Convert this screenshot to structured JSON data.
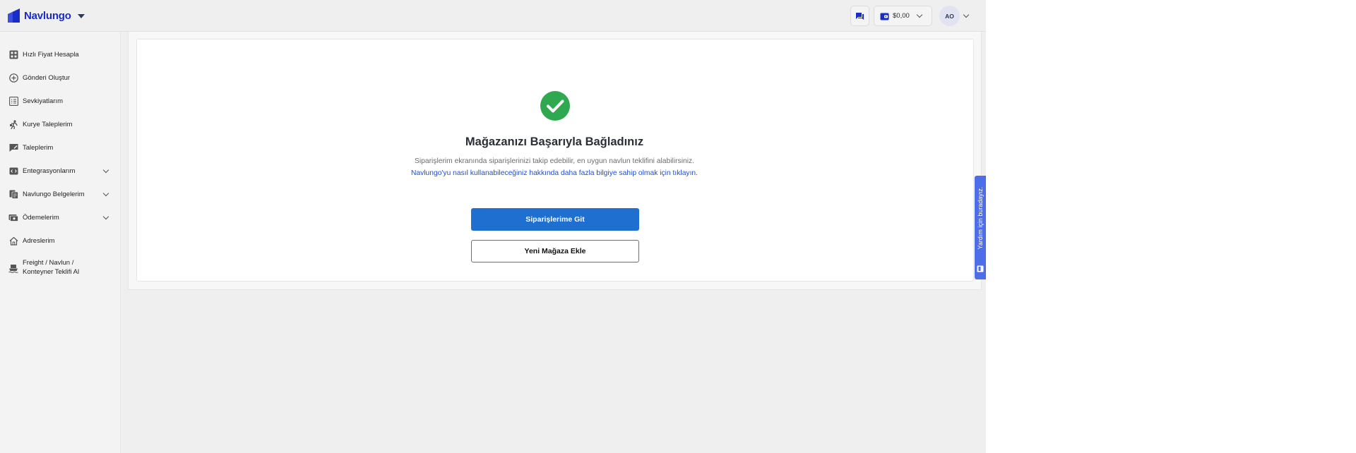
{
  "header": {
    "brand": "Navlungo",
    "wallet_amount": "$0,00",
    "user_initials": "AO"
  },
  "sidebar": {
    "items": [
      {
        "label": "Hızlı Fiyat Hesapla",
        "icon": "calculator-icon"
      },
      {
        "label": "Gönderi Oluştur",
        "icon": "plus-circle-icon"
      },
      {
        "label": "Sevkiyatlarım",
        "icon": "list-icon"
      },
      {
        "label": "Kurye Taleplerim",
        "icon": "courier-icon"
      },
      {
        "label": "Taleplerim",
        "icon": "request-icon"
      },
      {
        "label": "Entegrasyonlarım",
        "icon": "integration-icon",
        "expandable": true
      },
      {
        "label": "Navlungo Belgelerim",
        "icon": "documents-icon",
        "expandable": true
      },
      {
        "label": "Ödemelerim",
        "icon": "payment-icon",
        "expandable": true
      },
      {
        "label": "Adreslerim",
        "icon": "home-icon"
      },
      {
        "label_line1": "Freight / Navlun /",
        "label_line2": "Konteyner Teklifi Al",
        "icon": "ship-icon"
      }
    ]
  },
  "main": {
    "title": "Mağazanızı Başarıyla Bağladınız",
    "description": "Siparişlerim ekranında siparişlerinizi takip edebilir, en uygun navlun teklifini alabilirsiniz.",
    "help_link": "Navlungo'yu nasıl kullanabileceğiniz hakkında daha fazla bilgiye sahip olmak için tıklayın.",
    "primary_button": "Siparişlerime Git",
    "secondary_button": "Yeni Mağaza Ekle"
  },
  "help_tab": {
    "label": "Yardım için buradayız."
  },
  "colors": {
    "brand": "#1a2cc7",
    "primary_button": "#1f6fd1",
    "success": "#2fa84f",
    "help_tab": "#4d6ee8"
  }
}
